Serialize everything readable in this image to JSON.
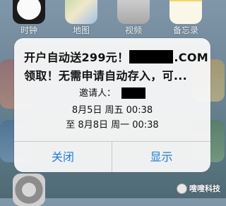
{
  "home_screen": {
    "apps": [
      {
        "label": "时钟",
        "icon": "clock-icon"
      },
      {
        "label": "地图",
        "icon": "maps-icon"
      },
      {
        "label": "视频",
        "icon": "video-icon"
      },
      {
        "label": "备忘录",
        "icon": "notes-icon"
      }
    ]
  },
  "alert": {
    "title_line1_prefix": "开户自动送299元！",
    "title_line1_suffix": ".COM",
    "title_line2": "领取！无需申请自动存入，可...",
    "inviter_label": "邀请人：",
    "time_start": "8月5日 周五 00:38",
    "time_end": "至 8月8日 周一 00:38",
    "close_label": "关闭",
    "show_label": "显示"
  },
  "watermark": {
    "text": "嗖嗖科技"
  },
  "colors": {
    "button_blue": "#1a7cf5",
    "redaction": "#000000"
  }
}
